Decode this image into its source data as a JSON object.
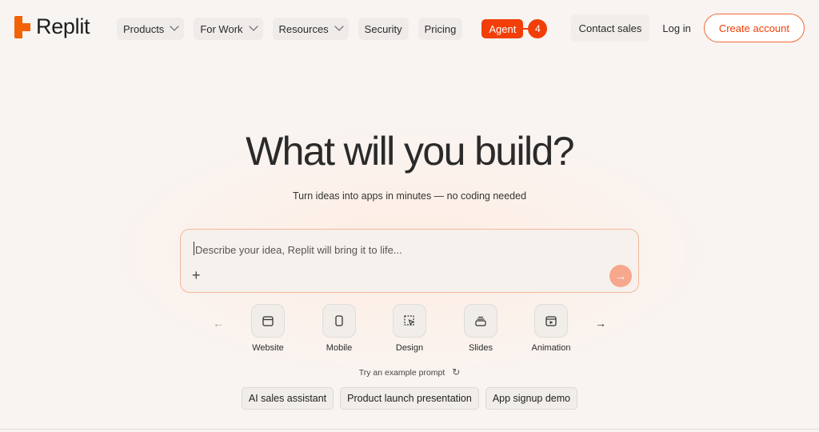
{
  "brand": {
    "name": "Replit",
    "accent": "#f26207",
    "agent_color": "#f23f0a"
  },
  "nav": {
    "items": [
      {
        "label": "Products",
        "dropdown": true
      },
      {
        "label": "For Work",
        "dropdown": true
      },
      {
        "label": "Resources",
        "dropdown": true
      },
      {
        "label": "Security",
        "dropdown": false
      },
      {
        "label": "Pricing",
        "dropdown": false
      }
    ],
    "agent_label": "Agent",
    "agent_count": "4",
    "contact_label": "Contact sales",
    "login_label": "Log in",
    "create_label": "Create account"
  },
  "hero": {
    "title": "What will you build?",
    "subtitle": "Turn ideas into apps in minutes — no coding needed"
  },
  "prompt": {
    "placeholder": "Describe your idea, Replit will bring it to life...",
    "value": "",
    "attach_glyph": "+",
    "send_glyph": "→"
  },
  "categories": [
    {
      "label": "Website",
      "icon": "browser-window-icon"
    },
    {
      "label": "Mobile",
      "icon": "phone-icon"
    },
    {
      "label": "Design",
      "icon": "design-select-icon"
    },
    {
      "label": "Slides",
      "icon": "slides-stack-icon"
    },
    {
      "label": "Animation",
      "icon": "animation-play-icon"
    }
  ],
  "carousel": {
    "prev_glyph": "←",
    "next_glyph": "→"
  },
  "examples": {
    "label": "Try an example prompt",
    "refresh_glyph": "↻",
    "chips": [
      "AI sales assistant",
      "Product launch presentation",
      "App signup demo"
    ]
  }
}
